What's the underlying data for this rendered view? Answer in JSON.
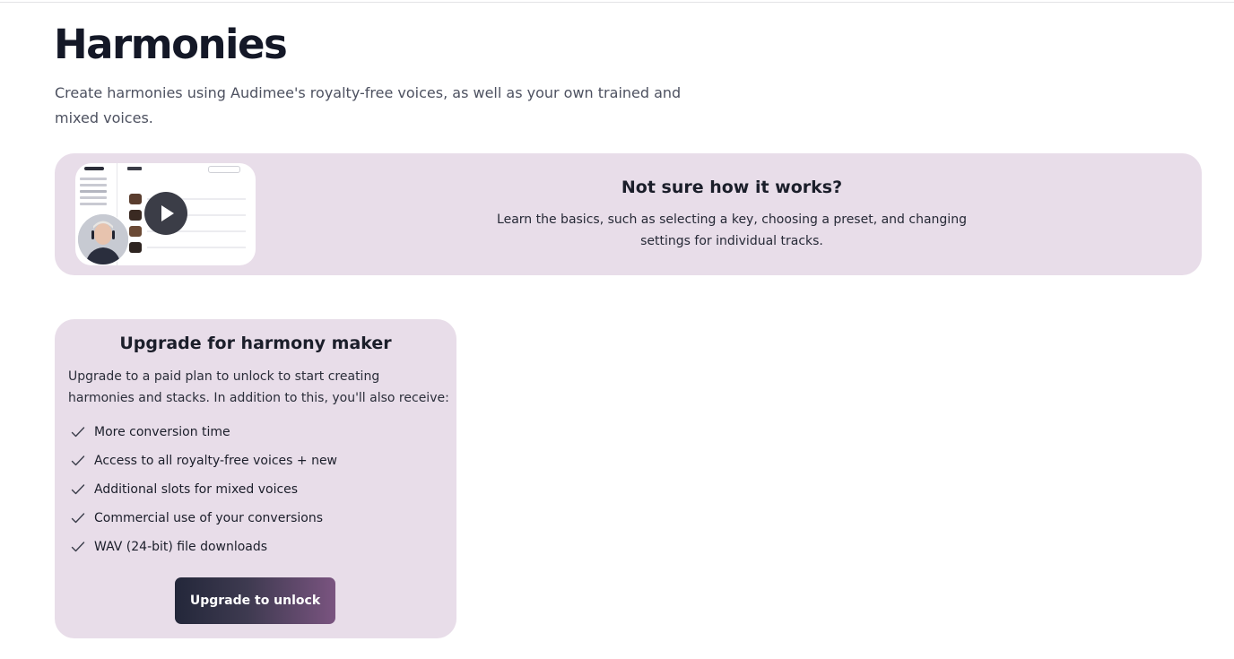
{
  "page": {
    "title": "Harmonies",
    "description": "Create harmonies using Audimee's royalty-free voices, as well as your own trained and mixed voices."
  },
  "help_banner": {
    "title": "Not sure how it works?",
    "description": "Learn the basics, such as selecting a key, choosing a preset, and changing settings for individual tracks.",
    "thumbnail_icon": "play-icon"
  },
  "upgrade": {
    "title": "Upgrade for harmony maker",
    "description": "Upgrade to a paid plan to unlock to start creating harmonies and stacks. In addition to this, you'll also receive:",
    "features": [
      "More conversion time",
      "Access to all royalty-free voices + new",
      "Additional slots for mixed voices",
      "Commercial use of your conversions",
      "WAV (24-bit) file downloads"
    ],
    "button_label": "Upgrade to unlock"
  },
  "colors": {
    "card_background": "#e8dde9",
    "button_gradient_start": "#23273a",
    "button_gradient_end": "#7a5480",
    "heading": "#141827"
  }
}
